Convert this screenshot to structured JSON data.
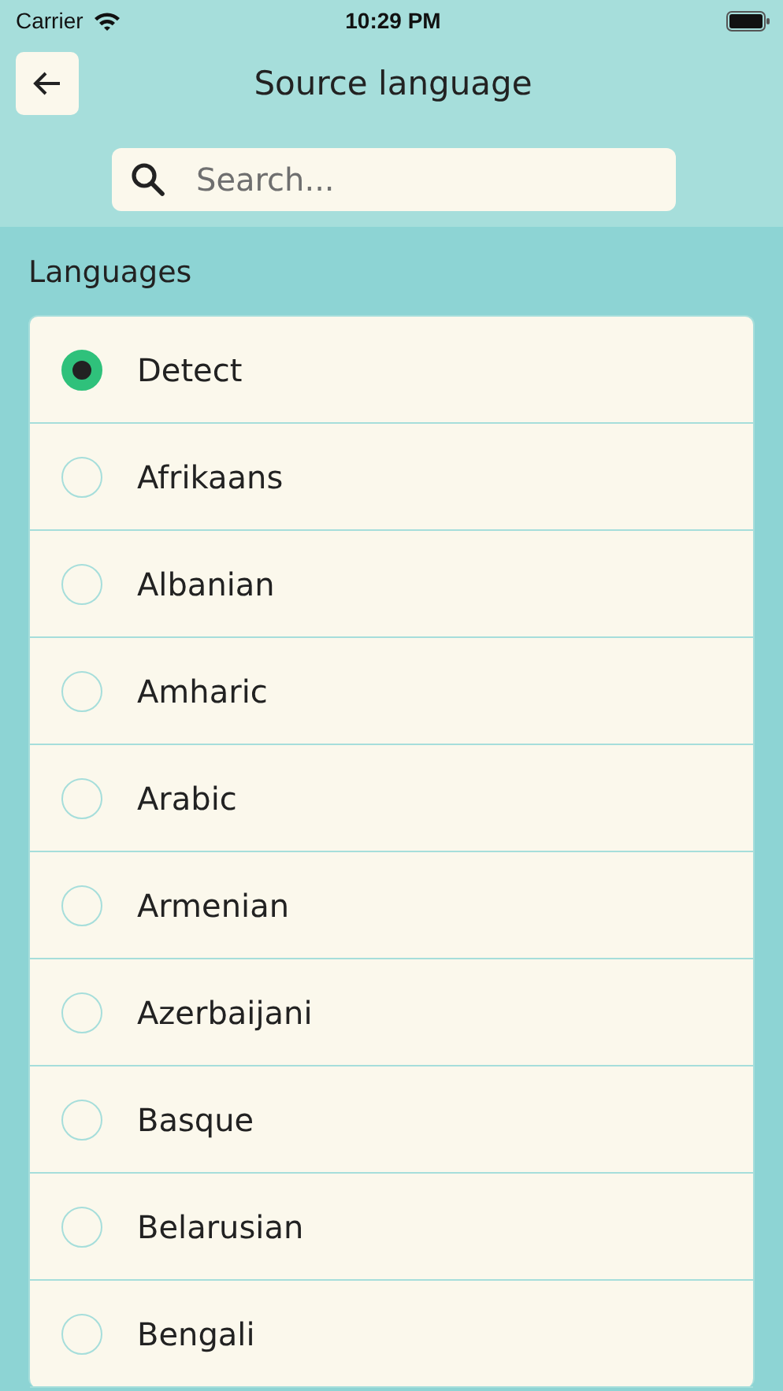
{
  "status_bar": {
    "carrier": "Carrier",
    "time": "10:29 PM"
  },
  "header": {
    "title": "Source language"
  },
  "search": {
    "placeholder": "Search..."
  },
  "section_title": "Languages",
  "languages": [
    {
      "name": "Detect",
      "selected": true
    },
    {
      "name": "Afrikaans",
      "selected": false
    },
    {
      "name": "Albanian",
      "selected": false
    },
    {
      "name": "Amharic",
      "selected": false
    },
    {
      "name": "Arabic",
      "selected": false
    },
    {
      "name": "Armenian",
      "selected": false
    },
    {
      "name": "Azerbaijani",
      "selected": false
    },
    {
      "name": "Basque",
      "selected": false
    },
    {
      "name": "Belarusian",
      "selected": false
    },
    {
      "name": "Bengali",
      "selected": false
    }
  ]
}
